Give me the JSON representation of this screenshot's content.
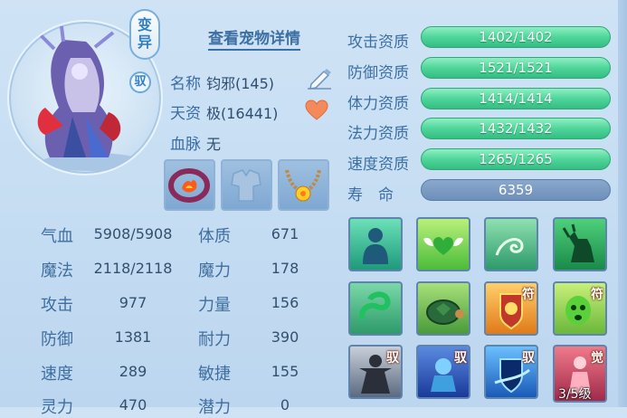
{
  "pet": {
    "badge_text": "变异",
    "mount_badge": "驭",
    "detail_link": "查看宠物详情",
    "name_label": "名称",
    "name_value": "钧邪(145)",
    "talent_label": "天资",
    "talent_value": "极(16441)",
    "bloodline_label": "血脉",
    "bloodline_value": "无"
  },
  "icons": {
    "edit": "pencil-icon",
    "favorite": "heart-icon",
    "equipment": [
      "collar-equipment-icon",
      "empty-armor-slot-icon",
      "necklace-equipment-icon"
    ]
  },
  "stats": [
    {
      "label": "气血",
      "value": "5908/5908"
    },
    {
      "label": "魔法",
      "value": "2118/2118"
    },
    {
      "label": "攻击",
      "value": "977"
    },
    {
      "label": "防御",
      "value": "1381"
    },
    {
      "label": "速度",
      "value": "289"
    },
    {
      "label": "灵力",
      "value": "470"
    }
  ],
  "attributes": [
    {
      "label": "体质",
      "value": "671"
    },
    {
      "label": "魔力",
      "value": "178"
    },
    {
      "label": "力量",
      "value": "156"
    },
    {
      "label": "耐力",
      "value": "390"
    },
    {
      "label": "敏捷",
      "value": "155"
    },
    {
      "label": "潜力",
      "value": "0"
    }
  ],
  "aptitudes": [
    {
      "label": "攻击资质",
      "value": "1402/1402"
    },
    {
      "label": "防御资质",
      "value": "1521/1521"
    },
    {
      "label": "体力资质",
      "value": "1414/1414"
    },
    {
      "label": "法力资质",
      "value": "1432/1432"
    },
    {
      "label": "速度资质",
      "value": "1265/1265"
    }
  ],
  "lifespan": {
    "label": "寿　命",
    "value": "6359"
  },
  "skills": {
    "tags": {
      "fu": "符",
      "yu": "驭",
      "jue": "觉"
    },
    "level": "3/5级"
  },
  "colors": {
    "aptitude_bar": "#4fd59a",
    "lifespan_bar": "#6d8fb9",
    "label_blue": "#3d6fa2"
  }
}
